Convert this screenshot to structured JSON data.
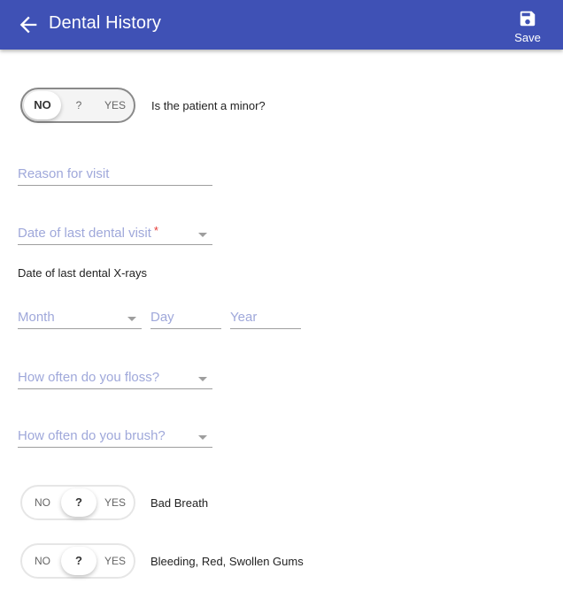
{
  "header": {
    "title": "Dental History",
    "back_icon": "arrow-left-icon",
    "save": {
      "label": "Save",
      "icon": "floppy-disk-icon"
    },
    "background": "#3f51b5"
  },
  "minor_question": {
    "options": [
      "NO",
      "?",
      "YES"
    ],
    "selected": "NO",
    "label": "Is the patient a minor?"
  },
  "fields": {
    "reason_for_visit": {
      "placeholder": "Reason for visit"
    },
    "last_dental_visit": {
      "placeholder": "Date of last dental visit",
      "required_mark": "*"
    },
    "xray_section_label": "Date of last dental X-rays",
    "xray_month": {
      "placeholder": "Month"
    },
    "xray_day": {
      "placeholder": "Day"
    },
    "xray_year": {
      "placeholder": "Year"
    },
    "floss_frequency": {
      "placeholder": "How often do you floss?"
    },
    "brush_frequency": {
      "placeholder": "How often do you brush?"
    }
  },
  "conditions": [
    {
      "label": "Bad Breath",
      "options": [
        "NO",
        "?",
        "YES"
      ],
      "selected": "?"
    },
    {
      "label": "Bleeding, Red, Swollen Gums",
      "options": [
        "NO",
        "?",
        "YES"
      ],
      "selected": "?"
    }
  ]
}
